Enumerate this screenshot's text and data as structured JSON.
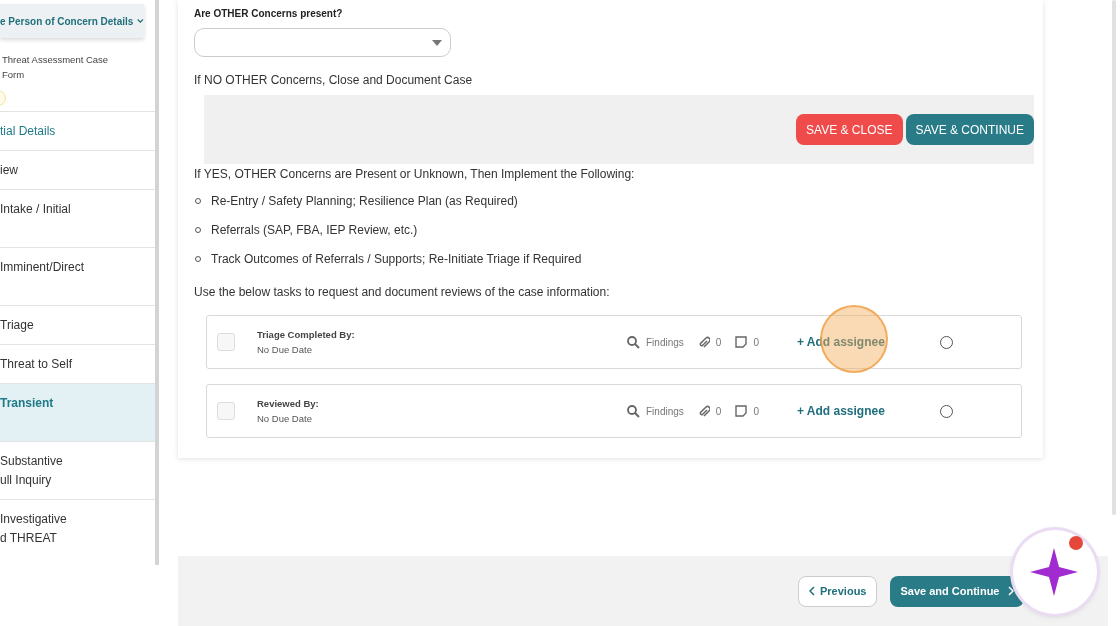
{
  "sidebar": {
    "header": "e Person of Concern Details",
    "form_title": [
      "Threat Assessment Case",
      "Form"
    ],
    "items": [
      {
        "lines": [
          "tial Details"
        ],
        "kind": "short",
        "selected": false,
        "accent": true
      },
      {
        "lines": [
          "iew"
        ],
        "kind": "short",
        "selected": false,
        "accent": false
      },
      {
        "lines": [
          "Intake / Initial"
        ],
        "kind": "tall",
        "selected": false,
        "accent": false
      },
      {
        "lines": [
          "Imminent/Direct"
        ],
        "kind": "tall",
        "selected": false,
        "accent": false
      },
      {
        "lines": [
          "Triage"
        ],
        "kind": "short",
        "selected": false,
        "accent": false
      },
      {
        "lines": [
          "Threat to Self"
        ],
        "kind": "short",
        "selected": false,
        "accent": false
      },
      {
        "lines": [
          "Transient"
        ],
        "kind": "tall",
        "selected": true,
        "accent": false
      },
      {
        "lines": [
          "Substantive",
          "ull Inquiry"
        ],
        "kind": "tall",
        "selected": false,
        "accent": false
      },
      {
        "lines": [
          "Investigative",
          "d THREAT"
        ],
        "kind": "end",
        "selected": false,
        "accent": false
      }
    ]
  },
  "form": {
    "question": "Are OTHER Concerns present?",
    "no_text": "If NO OTHER Concerns, Close and Document Case",
    "buttons": [
      {
        "label": "SAVE & CLOSE",
        "kind": "danger"
      },
      {
        "label": "SAVE & CONTINUE",
        "kind": "primary"
      }
    ],
    "yes_text": "If YES, OTHER Concerns are Present or Unknown, Then Implement the Following:",
    "bullets": [
      "Re-Entry / Safety Planning; Resilience Plan (as Required)",
      "Referrals (SAP, FBA, IEP Review, etc.)",
      "Track Outcomes of Referrals / Supports; Re-Initiate Triage if Required"
    ],
    "tasks_intro": "Use the below tasks to request and document reviews of the case information:",
    "tasks": [
      {
        "title": "Triage Completed By:",
        "due": "No Due Date",
        "findings": "Findings",
        "attachments": "0",
        "notes": "0",
        "assignee": "+ Add assignee",
        "checked": false,
        "selected": false,
        "highlighted": true
      },
      {
        "title": "Reviewed By:",
        "due": "No Due Date",
        "findings": "Findings",
        "attachments": "0",
        "notes": "0",
        "assignee": "+ Add assignee",
        "checked": false,
        "selected": false,
        "highlighted": false
      }
    ]
  },
  "footer": {
    "previous": "Previous",
    "next": "Save and Continue"
  }
}
